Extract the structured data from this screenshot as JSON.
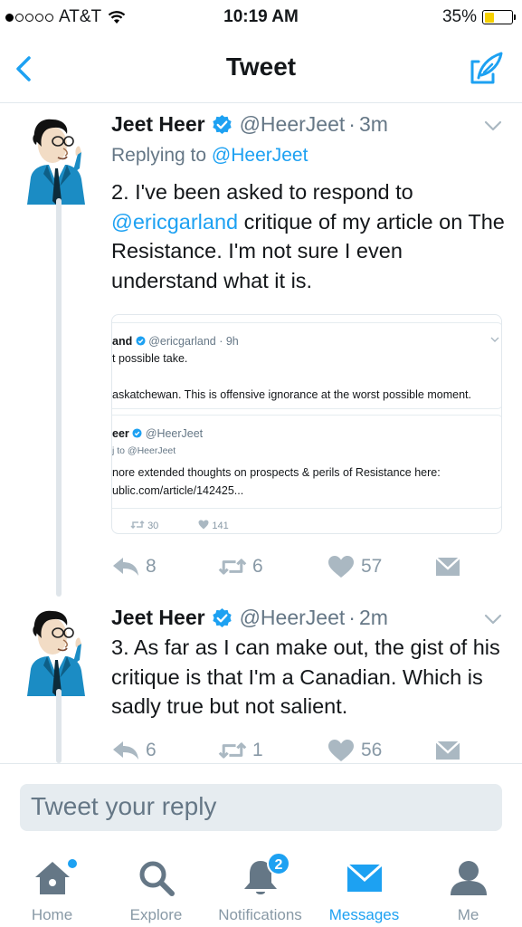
{
  "status_bar": {
    "carrier": "AT&T",
    "time": "10:19 AM",
    "battery_percent": "35%",
    "battery_level": 0.35
  },
  "nav": {
    "title": "Tweet",
    "back_icon": "chevron-left-icon",
    "compose_icon": "compose-tweet-icon"
  },
  "tweets": [
    {
      "name": "Jeet Heer",
      "handle": "@HeerJeet",
      "separator": "·",
      "time": "3m",
      "replying_prefix": "Replying to",
      "replying_to": "@HeerJeet",
      "text_before": "2. I've been asked to respond to",
      "mention": "@ericgarland",
      "text_after": "critique of my article on The Resistance. I'm not sure I even understand what it is.",
      "quote_image": {
        "top_name": "and",
        "top_handle": "@ericgarland · 9h",
        "top_line1": "t possible take.",
        "top_line2": "askatchewan. This is offensive ignorance at the worst possible moment.",
        "inner_name": "eer",
        "inner_handle": "@HeerJeet",
        "inner_replying": "j to @HeerJeet",
        "inner_line1": "nore extended thoughts on prospects & perils of Resistance here:",
        "inner_line2": "ublic.com/article/142425...",
        "retweets": "30",
        "likes": "141"
      },
      "replies": "8",
      "retweets": "6",
      "likes": "57"
    },
    {
      "name": "Jeet Heer",
      "handle": "@HeerJeet",
      "separator": "·",
      "time": "2m",
      "text": "3. As far as I can make out, the gist of his critique is that I'm a Canadian. Which is sadly true but not salient.",
      "replies": "6",
      "retweets": "1",
      "likes": "56"
    }
  ],
  "reply": {
    "placeholder": "Tweet your reply"
  },
  "tabs": [
    {
      "label": "Home",
      "icon": "home-icon"
    },
    {
      "label": "Explore",
      "icon": "search-icon"
    },
    {
      "label": "Notifications",
      "icon": "bell-icon",
      "badge": "2"
    },
    {
      "label": "Messages",
      "icon": "envelope-icon",
      "active": true
    },
    {
      "label": "Me",
      "icon": "person-icon"
    }
  ],
  "colors": {
    "accent": "#1da1f2",
    "muted": "#657786",
    "icon_gray": "#8899a6",
    "text": "#14171a"
  }
}
